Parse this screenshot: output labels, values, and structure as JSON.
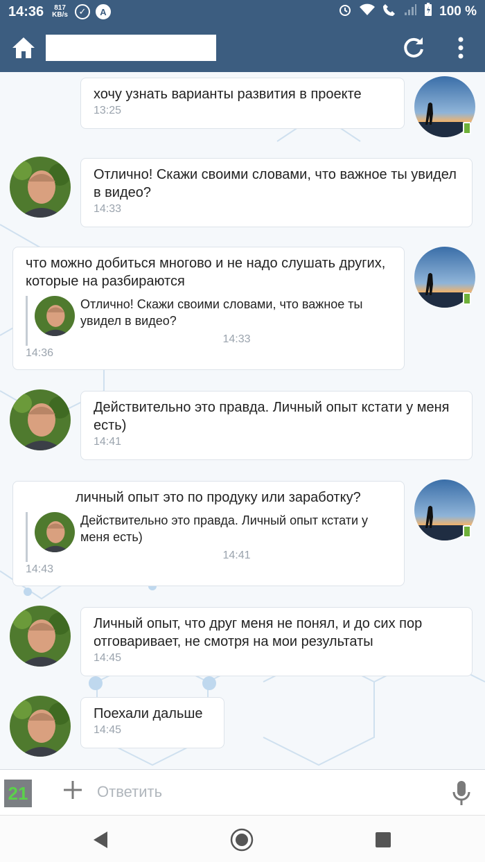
{
  "status_bar": {
    "time": "14:36",
    "speed_value": "817",
    "speed_unit": "KB/s",
    "icon_a": "A",
    "battery": "100 %"
  },
  "header": {
    "title": "",
    "home_icon": "home-icon",
    "refresh_icon": "refresh-icon",
    "menu_icon": "more-vert-icon"
  },
  "messages": [
    {
      "side": "right",
      "text": "хочу узнать варианты развития в проекте",
      "time": "13:25"
    },
    {
      "side": "left",
      "text": "Отлично! Скажи своими словами, что важное ты увидел в видео?",
      "time": "14:33"
    },
    {
      "side": "right",
      "text": "что можно добиться многово и не надо слушать других, которые на разбираются",
      "time": "14:36",
      "quote": {
        "text": "Отлично! Скажи своими словами, что важное ты увидел в видео?",
        "time": "14:33"
      }
    },
    {
      "side": "left",
      "text": "Действительно это правда. Личный опыт кстати у меня есть)",
      "time": "14:41"
    },
    {
      "side": "right",
      "text": "личный опыт это по продуку или заработку?",
      "time": "14:43",
      "quote": {
        "text": "Действительно это правда. Личный опыт кстати у меня есть)",
        "time": "14:41"
      }
    },
    {
      "side": "left",
      "text": "Личный опыт, что друг меня не понял, и до сих пор отговаривает, не смотря на мои результаты",
      "time": "14:45"
    },
    {
      "side": "left",
      "text": "Поехали дальше",
      "time": "14:45"
    }
  ],
  "composer": {
    "counter": "21",
    "placeholder": "Ответить",
    "value": ""
  },
  "colors": {
    "header_bg": "#3c5d80",
    "badge_green": "#6fb13a"
  }
}
